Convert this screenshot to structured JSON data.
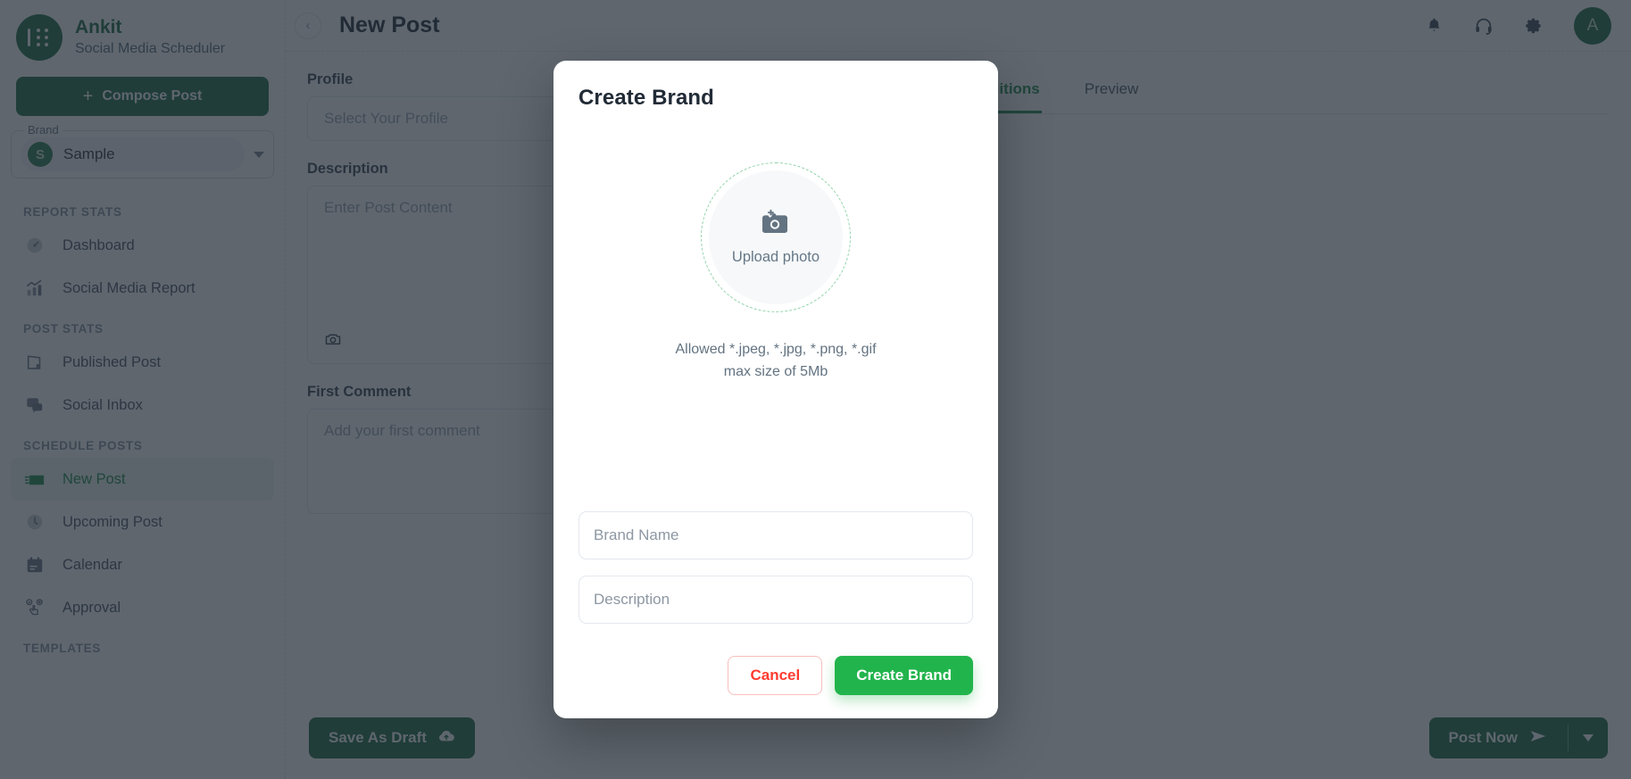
{
  "sidebar": {
    "logo_icon": "grid-dots-logo-icon",
    "app_name": "Ankit",
    "app_subtitle": "Social Media Scheduler",
    "compose_label": "Compose Post",
    "compose_icon": "plus-icon",
    "brand_legend": "Brand",
    "brand_avatar_letter": "S",
    "brand_value": "Sample",
    "brand_caret_icon": "chevron-down-icon",
    "sections": [
      {
        "title": "REPORT STATS",
        "items": [
          {
            "label": "Dashboard",
            "icon": "speedometer-icon",
            "active": false
          },
          {
            "label": "Social Media Report",
            "icon": "bar-chart-trend-icon",
            "active": false
          }
        ]
      },
      {
        "title": "POST STATS",
        "items": [
          {
            "label": "Published Post",
            "icon": "published-post-icon",
            "active": false
          },
          {
            "label": "Social Inbox",
            "icon": "chat-bubbles-icon",
            "active": false
          }
        ]
      },
      {
        "title": "SCHEDULE POSTS",
        "items": [
          {
            "label": "New Post",
            "icon": "send-envelope-icon",
            "active": true
          },
          {
            "label": "Upcoming Post",
            "icon": "clock-icon",
            "active": false
          },
          {
            "label": "Calendar",
            "icon": "calendar-icon",
            "active": false
          },
          {
            "label": "Approval",
            "icon": "approval-hand-icon",
            "active": false
          }
        ]
      },
      {
        "title": "TEMPLATES",
        "items": []
      }
    ]
  },
  "topbar": {
    "back_icon": "chevron-left-icon",
    "title": "New Post",
    "icons": [
      {
        "name": "notification-bell-icon"
      },
      {
        "name": "support-headset-icon"
      },
      {
        "name": "settings-gear-icon"
      }
    ],
    "avatar_letter": "A"
  },
  "main": {
    "profile_label": "Profile",
    "profile_placeholder": "Select Your Profile",
    "description_label": "Description",
    "description_placeholder": "Enter Post Content",
    "description_camera_icon": "camera-icon",
    "first_comment_label": "First Comment",
    "first_comment_placeholder": "Add your first comment",
    "tabs": [
      {
        "label": "Conditions",
        "active": true
      },
      {
        "label": "Preview",
        "active": false
      }
    ],
    "save_draft_label": "Save As Draft",
    "save_draft_icon": "cloud-upload-icon",
    "post_now_label": "Post Now",
    "post_now_icon": "send-plane-icon",
    "post_now_caret_icon": "chevron-down-icon"
  },
  "modal": {
    "title": "Create Brand",
    "upload_icon": "camera-plus-icon",
    "upload_label": "Upload photo",
    "allowed_line1": "Allowed *.jpeg, *.jpg, *.png, *.gif",
    "allowed_line2": "max size of 5Mb",
    "brand_name_placeholder": "Brand Name",
    "description_placeholder": "Description",
    "cancel_label": "Cancel",
    "create_label": "Create Brand"
  },
  "colors": {
    "brand_green": "#1f6b43",
    "accent_green": "#22b44c",
    "active_green": "#1f8b4c",
    "danger_red": "#ff3b30",
    "overlay": "rgba(33,43,54,0.72)"
  }
}
